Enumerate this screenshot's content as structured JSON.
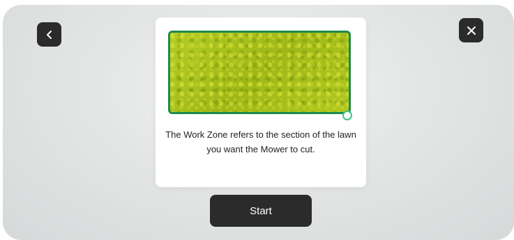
{
  "dialog": {
    "description": "The Work Zone refers to the section of the lawn you want the Mower to cut."
  },
  "actions": {
    "start_label": "Start"
  },
  "icons": {
    "back": "chevron-left-icon",
    "close": "close-icon"
  },
  "colors": {
    "button_bg": "#2b2b2b",
    "zone_border": "#1f8a4c",
    "zone_fill": "#a9c21b",
    "handle_border": "#3cc48a"
  }
}
